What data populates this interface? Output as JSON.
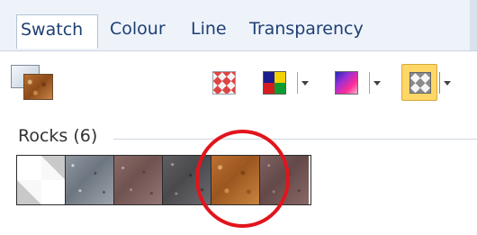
{
  "tabs": [
    {
      "label": "Swatch",
      "active": true
    },
    {
      "label": "Colour",
      "active": false
    },
    {
      "label": "Line",
      "active": false
    },
    {
      "label": "Transparency",
      "active": false
    }
  ],
  "toolbar": {
    "buttons": [
      {
        "name": "pattern-fill-icon"
      },
      {
        "name": "colour-fill-icon",
        "has_dropdown": true
      },
      {
        "name": "gradient-fill-icon",
        "has_dropdown": true
      },
      {
        "name": "swatch-fill-icon",
        "has_dropdown": true,
        "selected": true
      }
    ],
    "preview": {
      "name": "current-swatch-preview-icon"
    }
  },
  "group": {
    "label": "Rocks (6)"
  },
  "swatches": [
    {
      "name": "blank-swatch",
      "texture": "empty-checker"
    },
    {
      "name": "grey-rock-swatch",
      "texture": "grey-rock"
    },
    {
      "name": "brown-rock-swatch",
      "texture": "brown-rock"
    },
    {
      "name": "dark-grey-rock-swatch",
      "texture": "dark-grey-rock"
    },
    {
      "name": "orange-rock-swatch",
      "texture": "orange-rock",
      "highlighted": true
    },
    {
      "name": "dark-brown-rock-swatch",
      "texture": "dark-brown-rock"
    }
  ],
  "colors": {
    "tab_text": "#1e3f73",
    "accent": "#ffd766",
    "highlight_ring": "#e2141c"
  }
}
